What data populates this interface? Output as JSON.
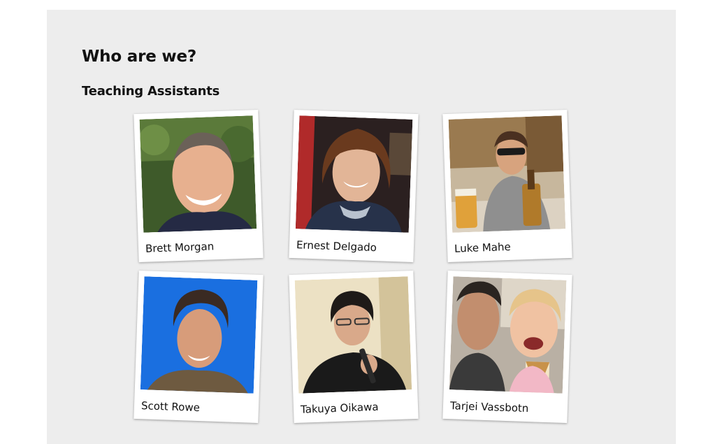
{
  "page": {
    "title": "Who are we?",
    "section_title": "Teaching Assistants"
  },
  "colors": {
    "panel_background": "#ededed",
    "page_background": "#ffffff",
    "card_background": "#ffffff",
    "text": "#111111"
  },
  "teaching_assistants": [
    {
      "name": "Brett Morgan",
      "photo_icon": "portrait-photo"
    },
    {
      "name": "Ernest Delgado",
      "photo_icon": "portrait-photo"
    },
    {
      "name": "Luke Mahe",
      "photo_icon": "portrait-photo"
    },
    {
      "name": "Scott Rowe",
      "photo_icon": "portrait-photo"
    },
    {
      "name": "Takuya Oikawa",
      "photo_icon": "portrait-photo"
    },
    {
      "name": "Tarjei Vassbotn",
      "photo_icon": "portrait-photo"
    }
  ]
}
